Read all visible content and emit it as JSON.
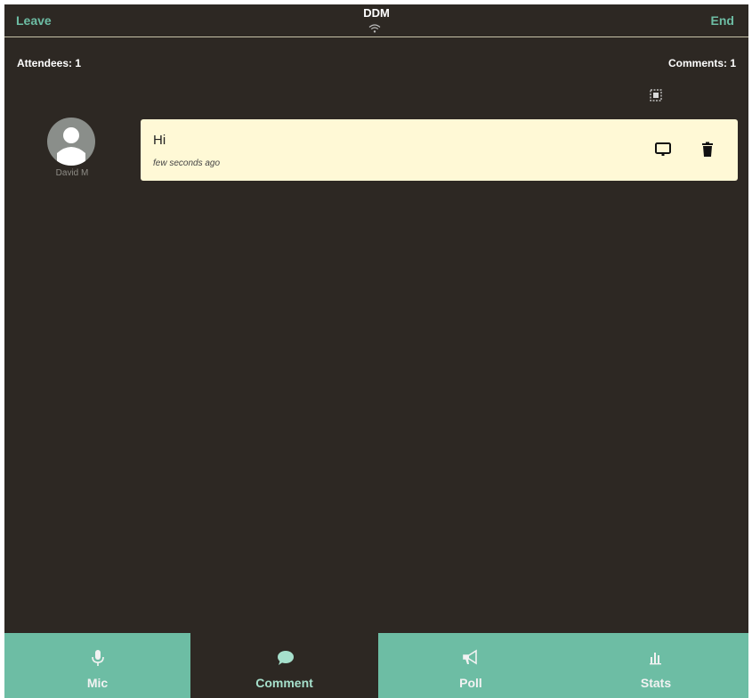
{
  "header": {
    "leave_label": "Leave",
    "title": "DDM",
    "end_label": "End"
  },
  "counts": {
    "attendees": "Attendees: 1",
    "comments": "Comments: 1"
  },
  "attendee": {
    "name": "David M"
  },
  "comment": {
    "text": "Hi",
    "time": "few seconds ago"
  },
  "tabs": [
    {
      "label": "Mic",
      "icon": "mic-icon"
    },
    {
      "label": "Comment",
      "icon": "speech-bubble-icon"
    },
    {
      "label": "Poll",
      "icon": "megaphone-icon"
    },
    {
      "label": "Stats",
      "icon": "bar-chart-icon"
    }
  ],
  "colors": {
    "background": "#2d2823",
    "accent": "#6dbda4",
    "comment_card": "#fff9d6"
  }
}
